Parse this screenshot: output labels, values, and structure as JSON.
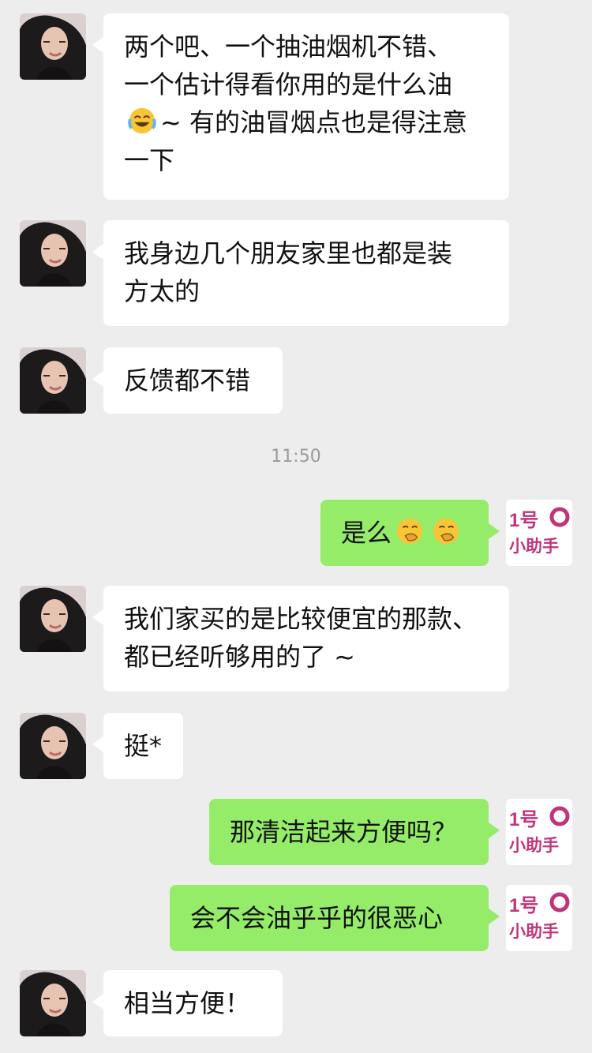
{
  "colors": {
    "background": "#ededed",
    "incoming_bubble": "#ffffff",
    "outgoing_bubble": "#95ec69",
    "timestamp": "#9a9a9a",
    "helper_brand": "#c2347a"
  },
  "icons": {
    "contact_avatar": "portrait-avatar",
    "self_avatar": "1hao-xiaozhushou-logo",
    "emoji_laugh": "tears-of-joy-emoji",
    "emoji_smirk": "covering-mouth-emoji"
  },
  "self_avatar_text": {
    "line1": "1号",
    "line2": "小助手"
  },
  "messages": {
    "m1": {
      "line1": "两个吧、一个抽油烟机不错、",
      "line2": "一个估计得看你用的是什么油",
      "line3_tail": "~ 有的油冒烟点也是得注意",
      "line4": "一下"
    },
    "m2": {
      "line1": "我身边几个朋友家里也都是装",
      "line2": "方太的"
    },
    "m3": {
      "text": "反馈都不错"
    },
    "time1": "11:50",
    "m4": {
      "text": "是么"
    },
    "m5": {
      "line1": "我们家买的是比较便宜的那款、",
      "line2": "都已经听够用的了 ~"
    },
    "m6": {
      "text": "挺*"
    },
    "m7": {
      "text": "那清洁起来方便吗？"
    },
    "m8": {
      "text": "会不会油乎乎的很恶心"
    },
    "m9": {
      "text": "相当方便！"
    }
  }
}
